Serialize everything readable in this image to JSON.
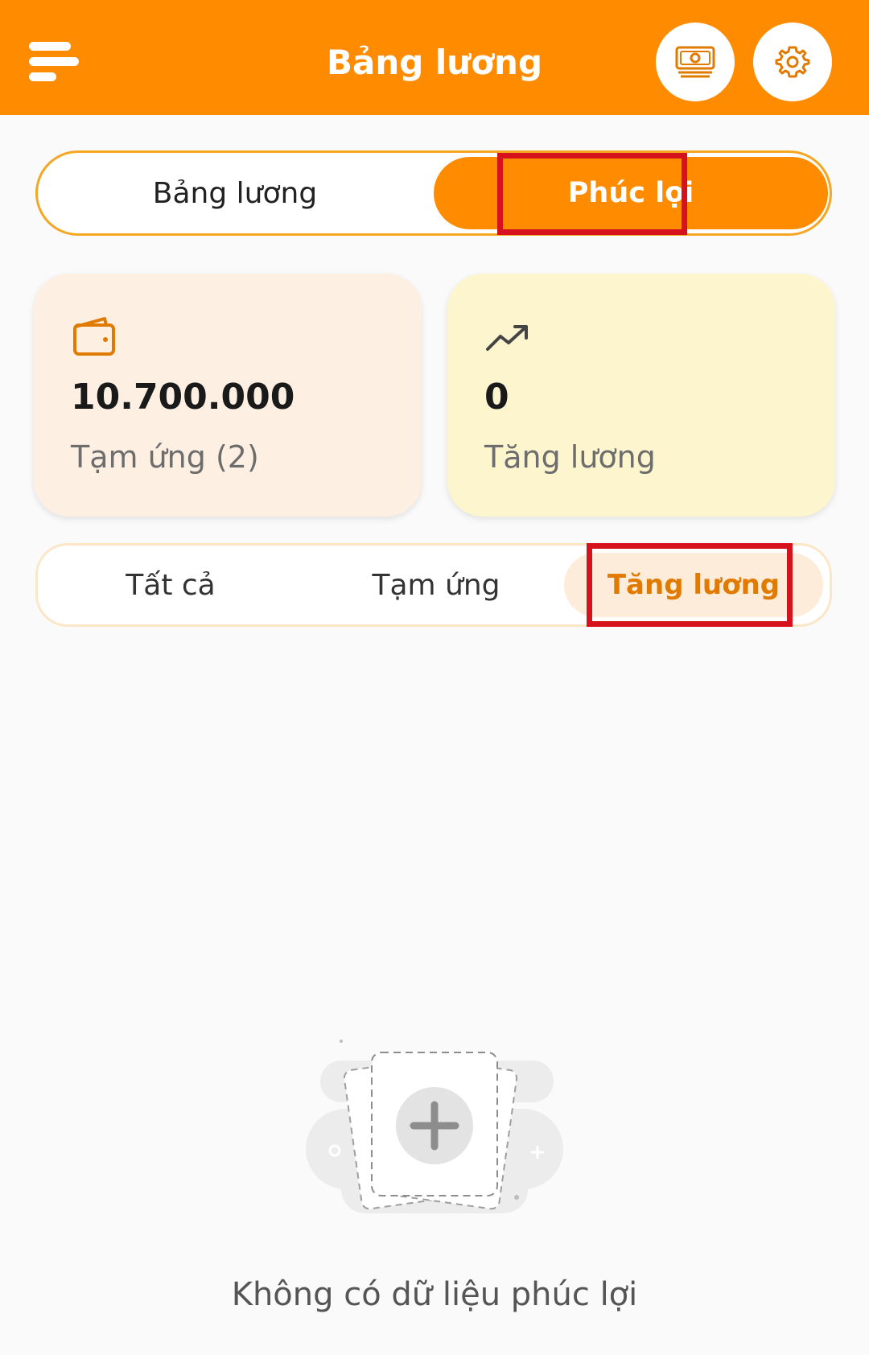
{
  "header": {
    "title": "Bảng lương",
    "menu_icon": "menu-icon",
    "money_icon": "money-icon",
    "settings_icon": "gear-icon",
    "color": "#ff8c00"
  },
  "segment": {
    "tabs": [
      {
        "label": "Bảng lương",
        "active": false
      },
      {
        "label": "Phúc lợi",
        "active": true
      }
    ]
  },
  "cards": [
    {
      "icon": "wallet-icon",
      "value": "10.700.000",
      "label": "Tạm ứng (2)"
    },
    {
      "icon": "trending-up-icon",
      "value": "0",
      "label": "Tăng lương"
    }
  ],
  "filters": {
    "tabs": [
      {
        "label": "Tất cả",
        "active": false
      },
      {
        "label": "Tạm ứng",
        "active": false
      },
      {
        "label": "Tăng lương",
        "active": true
      }
    ]
  },
  "empty_state": {
    "icon": "empty-add-illustration",
    "message": "Không có dữ liệu phúc lợi"
  },
  "colors": {
    "accent": "#ff8c00",
    "highlight": "#d6121c",
    "card_advance_bg": "#fdf0e3",
    "card_raise_bg": "#fdf5cd"
  }
}
